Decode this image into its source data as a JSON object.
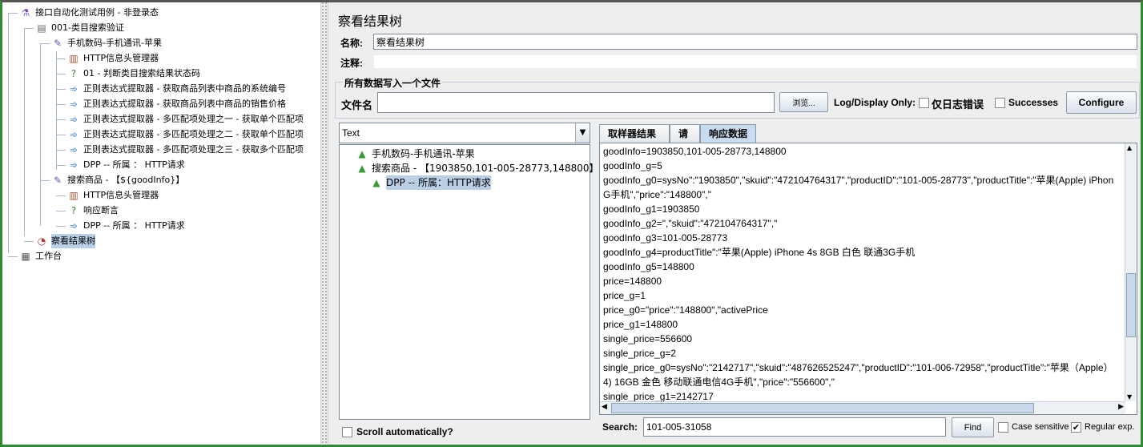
{
  "tree": [
    {
      "label": "接口自动化测试用例 - 非登录态",
      "icon": "flask-icon",
      "level": 0
    },
    {
      "label": "001-类目搜索验证",
      "icon": "thread-group-icon",
      "level": 1
    },
    {
      "label": "手机数码-手机通讯-苹果",
      "icon": "sampler-pipette-icon",
      "level": 2
    },
    {
      "label": "HTTP信息头管理器",
      "icon": "header-manager-icon",
      "level": 3
    },
    {
      "label": "01 - 判断类目搜索结果状态码",
      "icon": "assertion-icon",
      "level": 3
    },
    {
      "label": "正则表达式提取器 - 获取商品列表中商品的系统编号",
      "icon": "extractor-icon",
      "level": 3
    },
    {
      "label": "正则表达式提取器 - 获取商品列表中商品的销售价格",
      "icon": "extractor-icon",
      "level": 3
    },
    {
      "label": "正则表达式提取器 - 多匹配项处理之一 - 获取单个匹配项",
      "icon": "extractor-icon",
      "level": 3
    },
    {
      "label": "正则表达式提取器 - 多匹配项处理之二 - 获取单个匹配项",
      "icon": "extractor-icon",
      "level": 3
    },
    {
      "label": "正则表达式提取器 - 多匹配项处理之三 - 获取多个匹配项",
      "icon": "extractor-icon",
      "level": 3
    },
    {
      "label": "DPP  --  所属 ： HTTP请求",
      "icon": "extractor-icon",
      "level": 3
    },
    {
      "label": "搜索商品 - 【${goodInfo}】",
      "icon": "sampler-pipette-icon",
      "level": 2
    },
    {
      "label": "HTTP信息头管理器",
      "icon": "header-manager-icon",
      "level": 3
    },
    {
      "label": "响应断言",
      "icon": "assertion-icon",
      "level": 3
    },
    {
      "label": "DPP  --  所属 ： HTTP请求",
      "icon": "extractor-icon",
      "level": 3
    },
    {
      "label": "察看结果树",
      "icon": "listener-icon",
      "level": 1,
      "selected": true
    },
    {
      "label": "工作台",
      "icon": "workbench-icon",
      "level": 0
    }
  ],
  "panel": {
    "title": "察看结果树",
    "name_label": "名称:",
    "name_value": "察看结果树",
    "comment_label": "注释:",
    "comment_value": "",
    "file_group_title": "所有数据写入一个文件",
    "file_label": "文件名",
    "file_value": "",
    "browse_label": "浏览...",
    "log_display_label": "Log/Display Only:",
    "errors_only_label": "仅日志错误",
    "errors_only_checked": false,
    "successes_label": "Successes",
    "successes_checked": false,
    "configure_label": "Configure"
  },
  "results": {
    "renderer": "Text",
    "items": [
      {
        "label": "手机数码-手机通讯-苹果",
        "level": 0
      },
      {
        "label": "搜索商品 - 【1903850,101-005-28773,148800】",
        "level": 0
      },
      {
        "label": "DPP -- 所属：HTTP请求",
        "level": 1,
        "selected": true
      }
    ],
    "scroll_auto_label": "Scroll automatically?",
    "scroll_auto_checked": false
  },
  "tabs": [
    {
      "label": "取样器结果"
    },
    {
      "label": "请求"
    },
    {
      "label": "响应数据",
      "active": true
    }
  ],
  "response_lines": [
    "goodInfo=1903850,101-005-28773,148800",
    "goodInfo_g=5",
    "goodInfo_g0=sysNo\":\"1903850\",\"skuid\":\"472104764317\",\"productID\":\"101-005-28773\",\"productTitle\":\"苹果(Apple) iPhon",
    "G手机\",\"price\":\"148800\",\"",
    "goodInfo_g1=1903850",
    "goodInfo_g2=\",\"skuid\":\"472104764317\",\"",
    "goodInfo_g3=101-005-28773",
    "goodInfo_g4=productTitle\":\"苹果(Apple) iPhone 4s 8GB 白色 联通3G手机",
    "goodInfo_g5=148800",
    "price=148800",
    "price_g=1",
    "price_g0=\"price\":\"148800\",\"activePrice",
    "price_g1=148800",
    "single_price=556600",
    "single_price_g=2",
    "single_price_g0=sysNo\":\"2142717\",\"skuid\":\"487626525247\",\"productID\":\"101-006-72958\",\"productTitle\":\"苹果（Apple）",
    "4) 16GB 金色 移动联通电信4G手机\",\"price\":\"556600\",\"",
    "single_price_g1=2142717"
  ],
  "search": {
    "label": "Search:",
    "value": "101-005-31058",
    "find_label": "Find",
    "case_label": "Case sensitive",
    "case_checked": false,
    "regex_label": "Regular exp.",
    "regex_checked": true
  },
  "colors": {
    "border": "#2e8b34",
    "selection": "#b8cfe5",
    "tab_active": "#c9dbef"
  }
}
